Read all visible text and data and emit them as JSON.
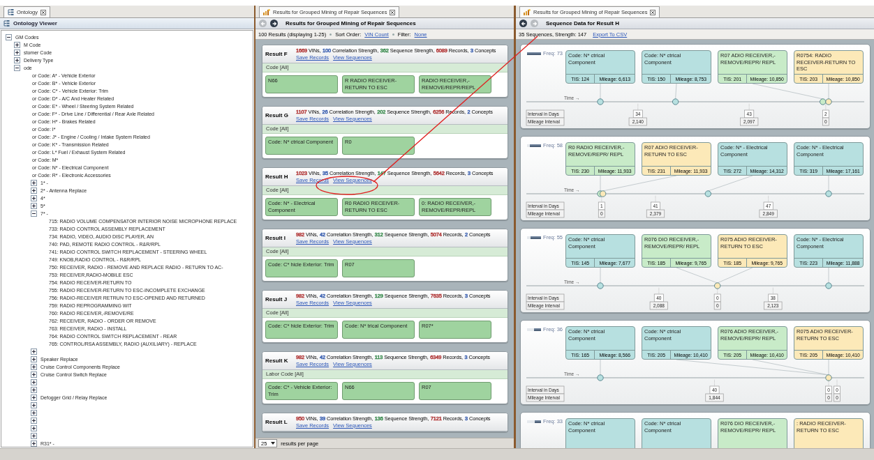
{
  "ontology_panel": {
    "tab": {
      "label": "Ontology"
    },
    "title": "Ontology Viewer",
    "tree": {
      "label": "GM Codes",
      "expanded": true,
      "children": [
        {
          "label": "M Code",
          "expanded": false
        },
        {
          "label": "stomer Code",
          "expanded": false
        },
        {
          "label": "Delivery Type",
          "expanded": false
        },
        {
          "label": "ode",
          "expanded": true,
          "children": [
            {
              "label": "or Code: A* - Vehicle Exterior"
            },
            {
              "label": "or Code: B* - Vehicle Exterior"
            },
            {
              "label": "or Code: C* - Vehicle Exterior: Trim"
            },
            {
              "label": "or Code: D* - A/C And Heater Related"
            },
            {
              "label": "or Code: E* - Wheel / Steering System Related"
            },
            {
              "label": "or Code: F* - Drive Line / Differential / Rear Axle Related"
            },
            {
              "label": "or Code: H* - Brakes Related"
            },
            {
              "label": "or Code: I*"
            },
            {
              "label": "or Code: J* - Engine / Cooling / Intake System Related"
            },
            {
              "label": "or Code: K* - Transmission Related"
            },
            {
              "label": "or Code: L* Fuel / Exhaust System Related"
            },
            {
              "label": "or Code: M*"
            },
            {
              "label": "or Code: N* - Electrical Component"
            },
            {
              "label": "or Code: R* - Electronic Accessories",
              "children": [
                {
                  "label": "1* -",
                  "expanded": false
                },
                {
                  "label": "2* - Antenna Replace",
                  "expanded": false
                },
                {
                  "label": "4*",
                  "expanded": false
                },
                {
                  "label": "5*",
                  "expanded": false
                },
                {
                  "label": "7* -",
                  "expanded": true,
                  "children": [
                    {
                      "label": "715: RADIO VOLUME COMPENSATOR INTERIOR NOISE MICROPHONE REPLACE"
                    },
                    {
                      "label": "733: RADIO CONTROL ASSEMBLY REPLACEMENT"
                    },
                    {
                      "label": "734: RADIO, VIDEO, AUDIO DISC PLAYER, AN"
                    },
                    {
                      "label": "740: PAD, REMOTE RADIO CONTROL - R&R/RPL"
                    },
                    {
                      "label": "741: RADIO CONTROL SWITCH REPLACEMENT - STEERING WHEEL"
                    },
                    {
                      "label": "749: KNOB,RADIO CONTROL - R&R/RPL"
                    },
                    {
                      "label": "750: RECEIVER, RADIO - REMOVE AND REPLACE RADIO - RETURN TO AC-"
                    },
                    {
                      "label": "753: RECEIVER,RADIO-MOBILE ESC"
                    },
                    {
                      "label": "754: RADIO RECEIVER-RETURN TO"
                    },
                    {
                      "label": "755: RADIO RECEIVER-RETURN TO ESC-INCOMPLETE EXCHANGE"
                    },
                    {
                      "label": "756: RADIO-RECEIVER RETRUN TO ESC-OPENED AND RETURNED"
                    },
                    {
                      "label": "759: RADIO REPROGRAMMING WIT"
                    },
                    {
                      "label": "760: RADIO RECEIVER,-REMOVE/RE"
                    },
                    {
                      "label": "762: RECEIVER, RADIO - ORDER OR REMOVE"
                    },
                    {
                      "label": "763: RECEIVER, RADIO - INSTALL"
                    },
                    {
                      "label": "764: RADIO CONTROL SWITCH REPLACEMENT - REAR"
                    },
                    {
                      "label": "765: CONTROL/RSA ASSEMBLY, RADIO (AUXILIARY) - REPLACE"
                    }
                  ]
                },
                {
                  "expanded": false
                },
                {
                  "label": "Speaker Replace",
                  "expanded": false
                },
                {
                  "label": "Cruise Control Components Replace",
                  "expanded": false
                },
                {
                  "label": "Cruise Control Switch Replace",
                  "expanded": false
                },
                {
                  "expanded": false
                },
                {
                  "expanded": false
                },
                {
                  "label": "Defogger Grid / Relay Replace",
                  "expanded": false
                },
                {
                  "expanded": false
                },
                {
                  "expanded": false
                },
                {
                  "expanded": false
                },
                {
                  "expanded": false
                },
                {
                  "expanded": false
                },
                {
                  "label": "R31* -",
                  "expanded": false
                }
              ]
            }
          ]
        }
      ]
    }
  },
  "results_panel": {
    "tab": {
      "label": "Results for Grouped Mining of Repair Sequences"
    },
    "nav": {
      "back_enabled": false,
      "forward_enabled": true
    },
    "title": "Results for Grouped Mining of Repair Sequences",
    "info": {
      "summary": "100 Results (displaying 1-25)",
      "sort_label": "Sort Order:",
      "sort_value": "VIN Count",
      "filter_label": "Filter:",
      "filter_value": "None"
    },
    "results": [
      {
        "title": "Result F",
        "stats": [
          {
            "value": "1669",
            "unit": "VINs,",
            "color": "#b23a3a"
          },
          {
            "value": "100",
            "unit": "Correlation Strength,",
            "color": "#3a5fb0"
          },
          {
            "value": "362",
            "unit": "Sequence Strength,",
            "color": "#3c8c50"
          },
          {
            "value": "6089",
            "unit": "Records,",
            "color": "#b23a3a"
          },
          {
            "value": "3",
            "unit": "Concepts",
            "color": "#3a5fb0"
          }
        ],
        "links": [
          "Save Records",
          "View Sequences"
        ],
        "group": "Code [All]",
        "concepts": [
          "N66",
          "R RADIO RECEIVER-RETURN TO ESC",
          "RADIO RECEIVER,-REMOVE/REPR/REPL"
        ]
      },
      {
        "title": "Result G",
        "stats": [
          {
            "value": "1107",
            "unit": "VINs,",
            "color": "#b23a3a"
          },
          {
            "value": "26",
            "unit": "Correlation Strength,",
            "color": "#3a5fb0"
          },
          {
            "value": "202",
            "unit": "Sequence Strength,",
            "color": "#3c8c50"
          },
          {
            "value": "6256",
            "unit": "Records,",
            "color": "#b23a3a"
          },
          {
            "value": "2",
            "unit": "Concepts",
            "color": "#3a5fb0"
          }
        ],
        "links": [
          "Save Records",
          "View Sequences"
        ],
        "group": "Code [All]",
        "concepts": [
          "Code: N* ctrical Component",
          "R0"
        ]
      },
      {
        "title": "Result H",
        "stats": [
          {
            "value": "1023",
            "unit": "VINs,",
            "color": "#b23a3a"
          },
          {
            "value": "35",
            "unit": "Correlation Strength,",
            "color": "#3a5fb0"
          },
          {
            "value": "147",
            "unit": "Sequence Strength,",
            "color": "#3c8c50"
          },
          {
            "value": "5642",
            "unit": "Records,",
            "color": "#b23a3a"
          },
          {
            "value": "3",
            "unit": "Concepts",
            "color": "#3a5fb0"
          }
        ],
        "links": [
          "Save Records",
          "View Sequences"
        ],
        "group": "Code [All]",
        "concepts": [
          "Code: N* - Electrical Component",
          "R0 RADIO RECEIVER-RETURN TO ESC",
          "0: RADIO RECEIVER,-REMOVE/REPR/REPL"
        ]
      },
      {
        "title": "Result I",
        "stats": [
          {
            "value": "982",
            "unit": "VINs,",
            "color": "#b23a3a"
          },
          {
            "value": "42",
            "unit": "Correlation Strength,",
            "color": "#3a5fb0"
          },
          {
            "value": "312",
            "unit": "Sequence Strength,",
            "color": "#3c8c50"
          },
          {
            "value": "5074",
            "unit": "Records,",
            "color": "#b23a3a"
          },
          {
            "value": "2",
            "unit": "Concepts",
            "color": "#3a5fb0"
          }
        ],
        "links": [
          "Save Records",
          "View Sequences"
        ],
        "group": "Code [All]",
        "concepts": [
          "Code: C* hicle Exterior: Trim",
          "R07"
        ]
      },
      {
        "title": "Result J",
        "stats": [
          {
            "value": "982",
            "unit": "VINs,",
            "color": "#b23a3a"
          },
          {
            "value": "42",
            "unit": "Correlation Strength,",
            "color": "#3a5fb0"
          },
          {
            "value": "129",
            "unit": "Sequence Strength,",
            "color": "#3c8c50"
          },
          {
            "value": "7635",
            "unit": "Records,",
            "color": "#b23a3a"
          },
          {
            "value": "3",
            "unit": "Concepts",
            "color": "#3a5fb0"
          }
        ],
        "links": [
          "Save Records",
          "View Sequences"
        ],
        "group": "Code [All]",
        "concepts": [
          "Code: C* hicle Exterior: Trim",
          "Code: N* trical Component",
          "R07*"
        ]
      },
      {
        "title": "Result K",
        "stats": [
          {
            "value": "982",
            "unit": "VINs,",
            "color": "#b23a3a"
          },
          {
            "value": "42",
            "unit": "Correlation Strength,",
            "color": "#3a5fb0"
          },
          {
            "value": "113",
            "unit": "Sequence Strength,",
            "color": "#3c8c50"
          },
          {
            "value": "6349",
            "unit": "Records,",
            "color": "#b23a3a"
          },
          {
            "value": "3",
            "unit": "Concepts",
            "color": "#3a5fb0"
          }
        ],
        "links": [
          "Save Records",
          "View Sequences"
        ],
        "group": "Labor Code [All]",
        "concepts": [
          "Code: C* - Vehicle Exterior: Trim",
          "N66",
          "R07"
        ]
      },
      {
        "title": "Result L",
        "stats": [
          {
            "value": "950",
            "unit": "VINs,",
            "color": "#b23a3a"
          },
          {
            "value": "39",
            "unit": "Correlation Strength,",
            "color": "#3a5fb0"
          },
          {
            "value": "136",
            "unit": "Sequence Strength,",
            "color": "#3c8c50"
          },
          {
            "value": "7121",
            "unit": "Records,",
            "color": "#b23a3a"
          },
          {
            "value": "3",
            "unit": "Concepts",
            "color": "#3a5fb0"
          }
        ],
        "links": [
          "Save Records",
          "View Sequences"
        ]
      }
    ],
    "pager": {
      "page_size": "25",
      "label": "results per page"
    }
  },
  "sequence_panel": {
    "tab": {
      "label": "Results for Grouped Mining of Repair Sequences"
    },
    "nav": {
      "back_enabled": true,
      "forward_enabled": false
    },
    "title": "Sequence Data for Result H",
    "summary": "35 Sequences, Strength: 147",
    "export_link": "Export To CSV",
    "sequences": [
      {
        "freq": "Freq: 73",
        "level": 1.0,
        "time_label": "Time →",
        "legend": [
          "Interval in Days",
          "Mileage Interval"
        ],
        "events": [
          {
            "label": "Code: N* ctrical Component",
            "tis": "TIS: 124",
            "mileage": "Mileage: 6,613",
            "color": "#b7e0e0"
          },
          {
            "label": "Code: N* ctrical Component",
            "tis": "TIS: 150",
            "mileage": "Mileage: 8,753",
            "color": "#b7e0e0"
          },
          {
            "label": "R07 ADIO RECEIVER,-REMOVE/REPR/ REPL",
            "tis": "TIS: 201",
            "mileage": "Mileage: 10,850",
            "color": "#c8ebc8"
          },
          {
            "label": "R0754: RADIO RECEIVER-RETURN TO ESC",
            "tis": "TIS: 203",
            "mileage": "Mileage: 10,850",
            "color": "#fce9b8"
          }
        ],
        "intervals": [
          {
            "days": "34",
            "mileage": "2,140"
          },
          {
            "days": "43",
            "mileage": "2,097"
          },
          {
            "days": "2",
            "mileage": "0"
          }
        ]
      },
      {
        "freq": "Freq: 58",
        "level": 0.8,
        "time_label": "Time →",
        "legend": [
          "Interval in Days",
          "Mileage Interval"
        ],
        "events": [
          {
            "label": "R0 RADIO RECEIVER,-REMOVE/REPR/ REPL",
            "tis": "TIS: 230",
            "mileage": "Mileage: 11,933",
            "color": "#c8ebc8"
          },
          {
            "label": "R07 ADIO RECEIVER-RETURN TO ESC",
            "tis": "TIS: 231",
            "mileage": "Mileage: 11,933",
            "color": "#fce9b8"
          },
          {
            "label": "Code: N* - Electrical Component",
            "tis": "TIS: 272",
            "mileage": "Mileage: 14,312",
            "color": "#b7e0e0"
          },
          {
            "label": "Code: N* - Electrical Component",
            "tis": "TIS: 319",
            "mileage": "Mileage: 17,161",
            "color": "#b7e0e0"
          }
        ],
        "intervals": [
          {
            "days": "1",
            "mileage": "0"
          },
          {
            "days": "41",
            "mileage": "2,379"
          },
          {
            "days": "47",
            "mileage": "2,849"
          }
        ]
      },
      {
        "freq": "Freq: 55",
        "level": 0.75,
        "time_label": "Time →",
        "legend": [
          "Interval in Days",
          "Mileage Interval"
        ],
        "events": [
          {
            "label": "Code: N* ctrical Component",
            "tis": "TIS: 145",
            "mileage": "Mileage: 7,677",
            "color": "#b7e0e0"
          },
          {
            "label": "R076 DIO RECEIVER,-REMOVE/REPR/ REPL",
            "tis": "TIS: 185",
            "mileage": "Mileage: 9,765",
            "color": "#c8ebc8"
          },
          {
            "label": "R075 ADIO RECEIVER-RETURN TO ESC",
            "tis": "TIS: 185",
            "mileage": "Mileage: 9,765",
            "color": "#fce9b8"
          },
          {
            "label": "Code: N* - Electrical Component",
            "tis": "TIS: 223",
            "mileage": "Mileage: 11,888",
            "color": "#b7e0e0"
          }
        ],
        "intervals": [
          {
            "days": "40",
            "mileage": "2,088"
          },
          {
            "days": "0",
            "mileage": "0"
          },
          {
            "days": "38",
            "mileage": "2,123"
          }
        ]
      },
      {
        "freq": "Freq: 36",
        "level": 0.5,
        "time_label": "Time →",
        "legend": [
          "Interval in Days",
          "Mileage Interval"
        ],
        "events": [
          {
            "label": "Code: N* ctrical Component",
            "tis": "TIS: 165",
            "mileage": "Mileage: 8,566",
            "color": "#b7e0e0"
          },
          {
            "label": "Code: N* ctrical Component",
            "tis": "TIS: 205",
            "mileage": "Mileage: 10,410",
            "color": "#b7e0e0"
          },
          {
            "label": "R076 ADIO RECEIVER,-REMOVE/REPR/ REPL",
            "tis": "TIS: 205",
            "mileage": "Mileage: 10,410",
            "color": "#c8ebc8"
          },
          {
            "label": "R075 ADIO RECEIVER-RETURN TO ESC",
            "tis": "TIS: 205",
            "mileage": "Mileage: 10,410",
            "color": "#fce9b8"
          }
        ],
        "intervals": [
          {
            "days": "40",
            "mileage": "1,844"
          },
          {
            "days": "0",
            "mileage": "0"
          },
          {
            "days": "0",
            "mileage": "0"
          }
        ]
      },
      {
        "freq": "Freq: 33",
        "level": 0.45,
        "events": [
          {
            "label": "Code: N* ctrical Component",
            "color": "#b7e0e0"
          },
          {
            "label": "Code: N* ctrical Component",
            "color": "#b7e0e0"
          },
          {
            "label": "R076 DIO RECEIVER,-REMOVE/REPR/ REPL",
            "color": "#c8ebc8"
          },
          {
            "label": ": RADIO RECEIVER-RETURN TO ESC",
            "color": "#fce9b8"
          }
        ]
      }
    ]
  }
}
